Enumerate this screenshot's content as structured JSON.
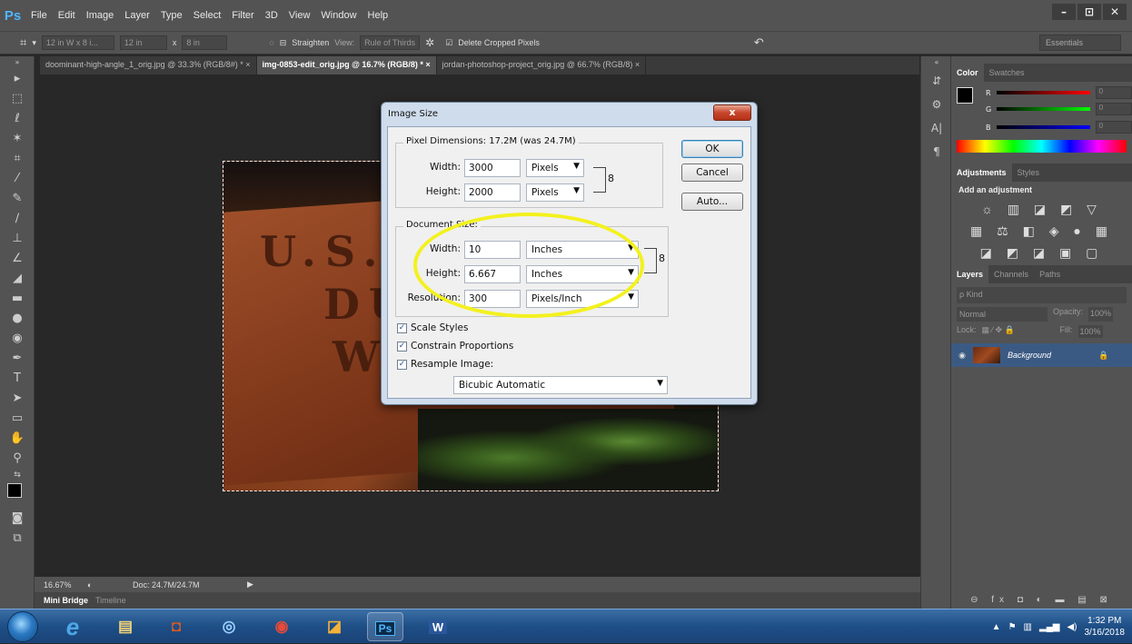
{
  "app": {
    "logo": "Ps"
  },
  "menu": [
    "File",
    "Edit",
    "Image",
    "Layer",
    "Type",
    "Select",
    "Filter",
    "3D",
    "View",
    "Window",
    "Help"
  ],
  "window_controls": [
    "–",
    "⊡",
    "✕"
  ],
  "options_bar": {
    "ratio": "12 in W x 8 i...",
    "width": "12 in",
    "x": "x",
    "height": "8 in",
    "straighten": "Straighten",
    "view_label": "View:",
    "view_value": "Rule of Thirds",
    "delete_cropped": "Delete Cropped Pixels",
    "workspace": "Essentials"
  },
  "tabs": [
    {
      "label": "doominant-high-angle_1_orig.jpg @ 33.3% (RGB/8#) *",
      "close": "×"
    },
    {
      "label": "img-0853-edit_orig.jpg @ 16.7% (RGB/8) *",
      "close": "×"
    },
    {
      "label": "jordan-photoshop-project_orig.jpg @ 66.7% (RGB/8)",
      "close": "×"
    }
  ],
  "photo": {
    "letters_line1": "U.S. F",
    "letters_line2": "DU",
    "letters_line3": "W"
  },
  "status": {
    "zoom": "16.67%",
    "doc": "Doc: 24.7M/24.7M"
  },
  "bottom_tabs": {
    "mini_bridge": "Mini Bridge",
    "timeline": "Timeline"
  },
  "color_panel": {
    "tabs": [
      "Color",
      "Swatches"
    ],
    "r_label": "R",
    "r_value": "0",
    "g_label": "G",
    "g_value": "0",
    "b_label": "B",
    "b_value": "0"
  },
  "adjustments_panel": {
    "tabs": [
      "Adjustments",
      "Styles"
    ],
    "heading": "Add an adjustment",
    "row1": "☼ ▥ ◪ ◩ ▽",
    "row2": "▦ ⚖ ◧ ◈ ● ▦",
    "row3": "◪ ◩ ◪ ▣ ▢"
  },
  "layers_panel": {
    "tabs": [
      "Layers",
      "Channels",
      "Paths"
    ],
    "kind": "ρ Kind",
    "blend": "Normal",
    "opacity_label": "Opacity:",
    "opacity_value": "100%",
    "lock_label": "Lock:",
    "fill_label": "Fill:",
    "fill_value": "100%",
    "layer_name": "Background",
    "footer_icons": "⊖ fx ◘ ◐ ▬ ▤ ⊠"
  },
  "dialog": {
    "title": "Image Size",
    "close": "x",
    "pixel_dimensions": "Pixel Dimensions:  17.2M (was 24.7M)",
    "pd_width_label": "Width:",
    "pd_width_value": "3000",
    "pd_width_unit": "Pixels",
    "pd_height_label": "Height:",
    "pd_height_value": "2000",
    "pd_height_unit": "Pixels",
    "document_size": "Document Size:",
    "ds_width_label": "Width:",
    "ds_width_value": "10",
    "ds_width_unit": "Inches",
    "ds_height_label": "Height:",
    "ds_height_value": "6.667",
    "ds_height_unit": "Inches",
    "res_label": "Resolution:",
    "res_value": "300",
    "res_unit": "Pixels/Inch",
    "scale_styles": "Scale Styles",
    "constrain": "Constrain Proportions",
    "resample": "Resample Image:",
    "resample_method": "Bicubic Automatic",
    "ok": "OK",
    "cancel": "Cancel",
    "auto": "Auto..."
  },
  "taskbar": {
    "ps": "Ps",
    "word": "W",
    "time": "1:32 PM",
    "date": "3/16/2018"
  }
}
